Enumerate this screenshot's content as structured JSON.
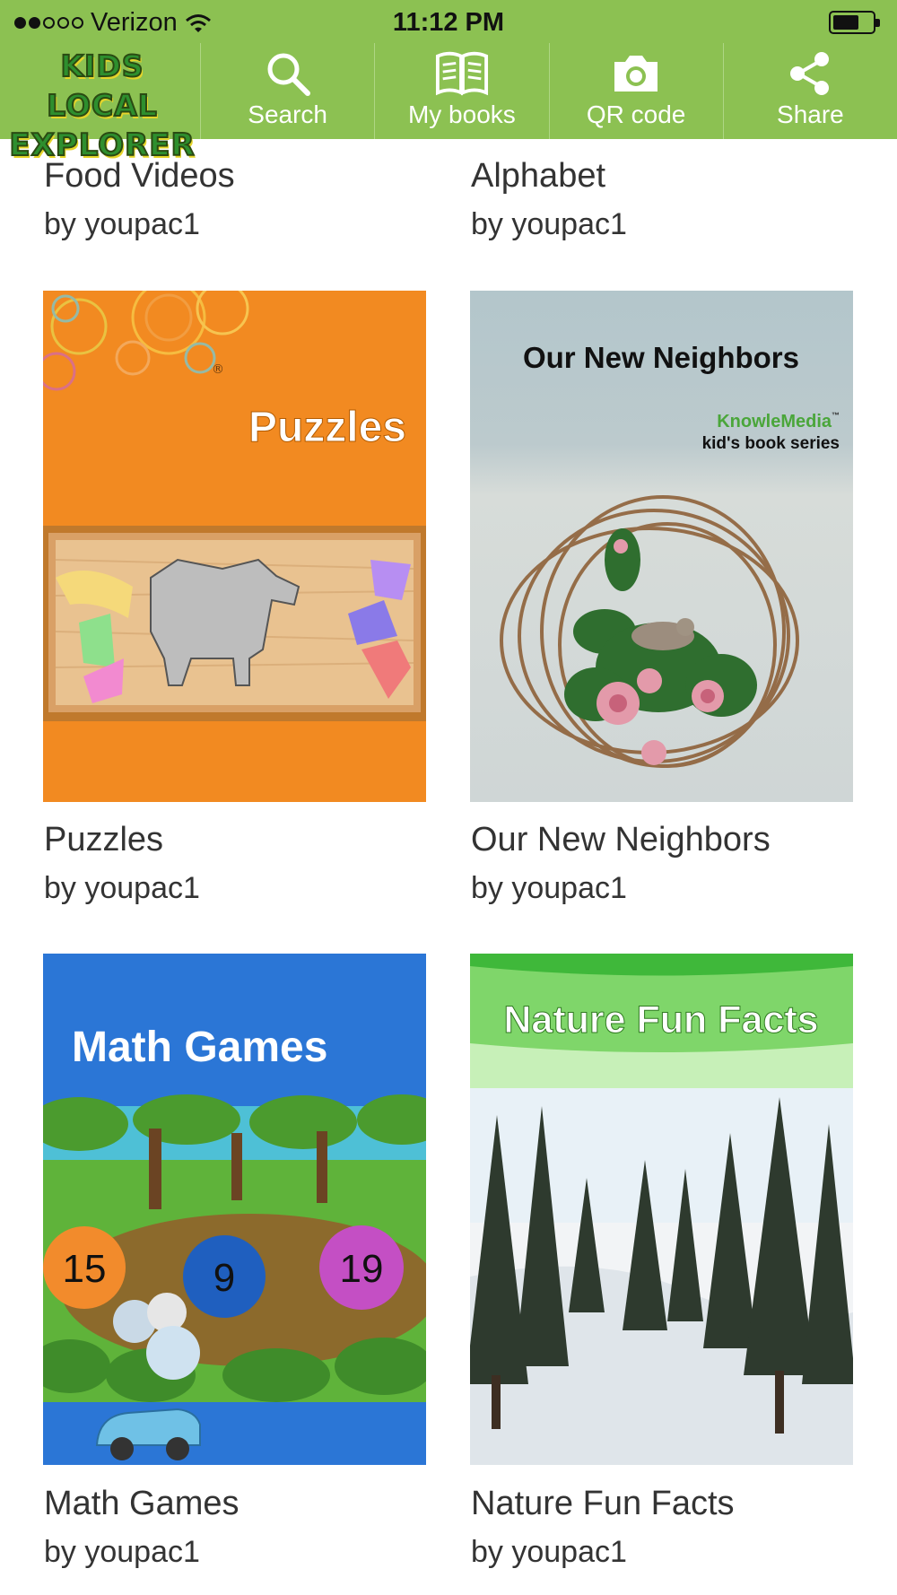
{
  "status_bar": {
    "carrier": "Verizon",
    "time": "11:12 PM",
    "signal_bars_filled": 2,
    "signal_bars_total": 5
  },
  "app": {
    "logo_line1": "KIDS LOCAL",
    "logo_line2": "EXPLORER",
    "accent": "#8cc152"
  },
  "nav": [
    {
      "label": "Search",
      "icon": "search-icon"
    },
    {
      "label": "My books",
      "icon": "book-icon"
    },
    {
      "label": "QR code",
      "icon": "camera-icon"
    },
    {
      "label": "Share",
      "icon": "share-icon"
    }
  ],
  "books": [
    {
      "title": "Food Videos",
      "author": "by youpac1"
    },
    {
      "title": "Alphabet",
      "author": "by youpac1"
    },
    {
      "title": "Puzzles",
      "author": "by youpac1",
      "cover_text": "Puzzles",
      "cover_mark": "®",
      "color": "#f28a21"
    },
    {
      "title": "Our New Neighbors",
      "author": "by youpac1",
      "cover_text": "Our New Neighbors",
      "publisher": "KnowleMedia",
      "publisher_tm": "™",
      "series": "kid's book series",
      "color": "#b9c8cc"
    },
    {
      "title": "Math Games",
      "author": "by youpac1",
      "cover_text": "Math Games",
      "balloons": [
        "15",
        "9",
        "19"
      ],
      "color": "#2b76d6"
    },
    {
      "title": "Nature Fun Facts",
      "author": "by youpac1",
      "cover_text": "Nature Fun Facts",
      "color": "#7fd66a"
    }
  ]
}
